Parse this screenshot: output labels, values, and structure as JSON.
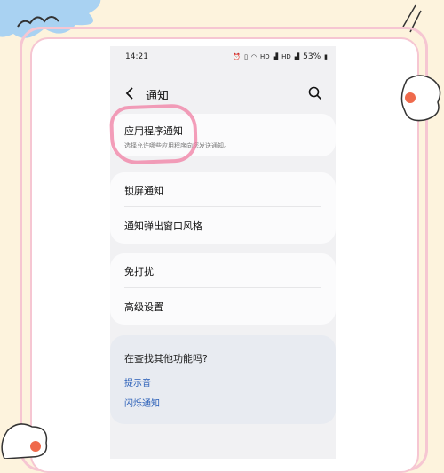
{
  "status_bar": {
    "time": "14:21",
    "icons": [
      "alarm-icon",
      "vibrate-icon",
      "wifi-icon",
      "hd-icon",
      "signal-icon",
      "hd-icon",
      "signal-icon"
    ],
    "battery": "53%"
  },
  "header": {
    "title": "通知"
  },
  "section1": {
    "app_notifications": {
      "title": "应用程序通知",
      "subtitle": "选择允许哪些应用程序向您发送通知。"
    }
  },
  "section2": {
    "items": [
      "锁屏通知",
      "通知弹出窗口风格"
    ]
  },
  "section3": {
    "items": [
      "免打扰",
      "高级设置"
    ]
  },
  "section4": {
    "title": "在查找其他功能吗?",
    "links": [
      "提示音",
      "闪烁通知"
    ]
  },
  "colors": {
    "page_bg": "#fdf3dd",
    "frame_pink": "#f6c6d2",
    "highlight_pink": "#f07ea3",
    "link_blue": "#2a5fb8",
    "screen_bg": "#f1f1f3"
  }
}
